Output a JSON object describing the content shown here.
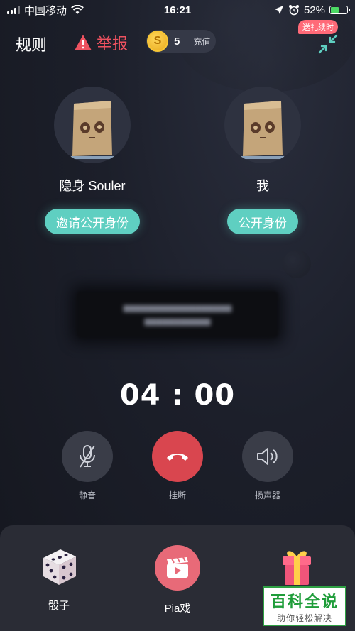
{
  "status_bar": {
    "carrier": "中国移动",
    "time": "16:21",
    "battery": "52%",
    "battery_level": 0.52
  },
  "top_bar": {
    "rules_label": "规则",
    "report_label": "举报",
    "coin_symbol": "S",
    "coin_count": "5",
    "recharge_label": "充值"
  },
  "users": {
    "left": {
      "name": "隐身 Souler",
      "button_label": "邀请公开身份"
    },
    "right": {
      "name": "我",
      "button_label": "公开身份"
    }
  },
  "timer": {
    "minutes": "04",
    "separator": ":",
    "seconds": "00"
  },
  "controls": {
    "mute_label": "静音",
    "hangup_label": "挂断",
    "speaker_label": "扬声器"
  },
  "tools": {
    "dice_label": "骰子",
    "pia_label": "Pia戏",
    "gift_badge": "送礼续时"
  },
  "watermark": {
    "title": "百科全说",
    "subtitle": "助你轻松解决"
  },
  "colors": {
    "accent_teal": "#5fcfc1",
    "report_red": "#ee5260",
    "hangup_red": "#d9464f",
    "coin_gold": "#f8c736"
  }
}
